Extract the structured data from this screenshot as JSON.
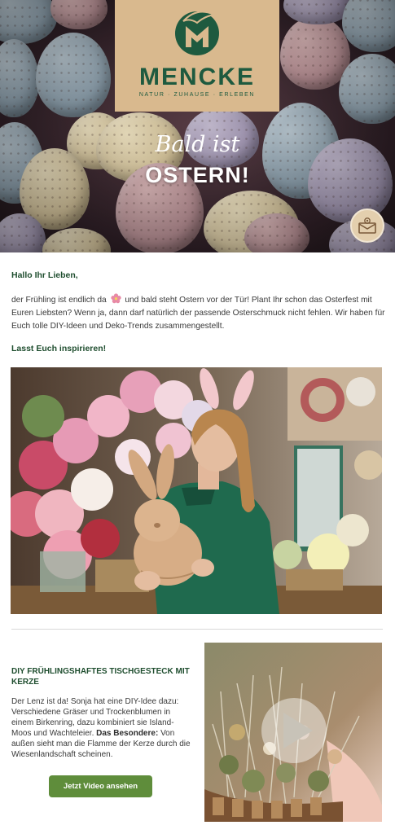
{
  "header": {
    "brand_name": "MENCKE",
    "brand_tagline": "NATUR · ZUHAUSE · ERLEBEN",
    "script_line": "Bald ist",
    "title": "OSTERN!",
    "mail_icon": "mail-envelope-icon",
    "brand_color": "#1e5a3f",
    "card_color": "#d9b98e"
  },
  "intro": {
    "greeting": "Hallo Ihr Lieben,",
    "paragraph_part1": "der Frühling ist endlich da",
    "flower_icon": "cherry-blossom-icon",
    "paragraph_part2": "und bald steht Ostern vor der Tür! Plant Ihr schon das Osterfest mit Euren Liebsten? Wenn ja, dann darf natürlich der passende Osterschmuck nicht fehlen. Wir haben für Euch tolle DIY-Ideen und Deko-Trends zusammengestellt.",
    "cta_line": "Lasst Euch inspirieren!"
  },
  "diy": {
    "title": "DIY Frühlingshaftes Tischgesteck mit Kerze",
    "text_part1": "Der Lenz ist da! Sonja hat eine DIY-Idee dazu: Verschiedene Gräser und Trockenblumen in einem Birkenring, dazu kombiniert sie Island-Moos und Wachteleier.",
    "text_bold": "Das Besondere:",
    "text_part2": "Von außen sieht man die Flamme der Kerze durch die Wiesenlandschaft scheinen.",
    "button_label": "Jetzt Video ansehen",
    "button_color": "#5f8d3b",
    "play_icon": "play-icon"
  }
}
